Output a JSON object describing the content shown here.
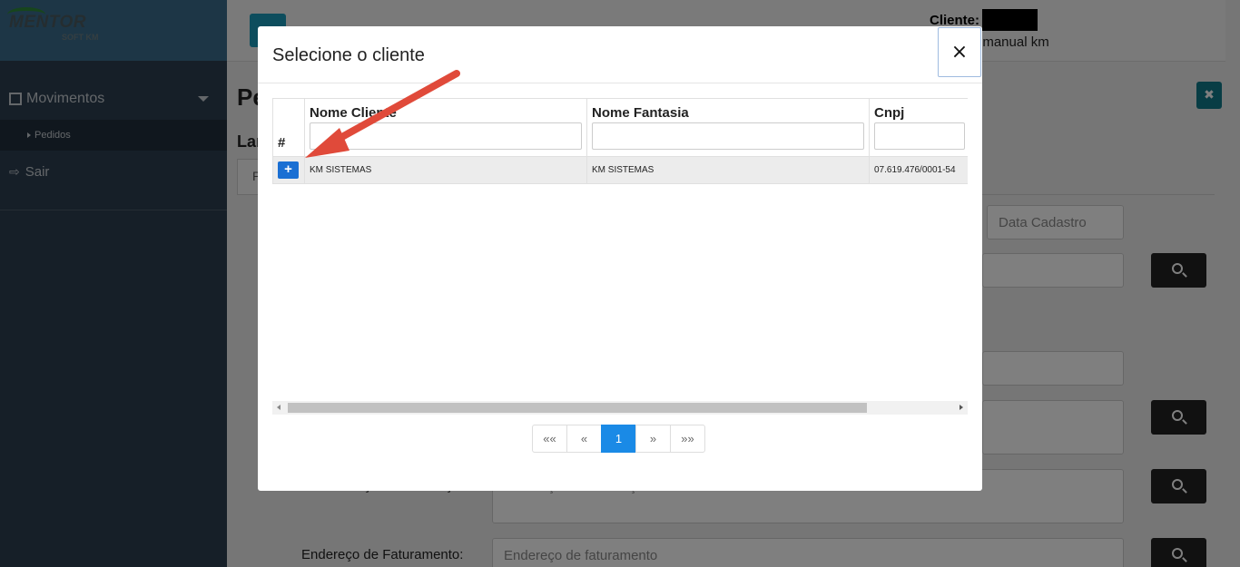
{
  "sidebar": {
    "logo": {
      "main": "MENTOR",
      "sub": "SOFT  KM"
    },
    "nav": {
      "movimentos": "Movimentos",
      "pedidos": "Pedidos",
      "sair": "Sair"
    }
  },
  "topbar": {
    "cliente_label": "Cliente:",
    "cliente_sub": ": manual km"
  },
  "page": {
    "title_partial": "Pe",
    "section_partial": "Lar",
    "tab_partial": "P",
    "close_icon": "✖",
    "data_cadastro_placeholder": "Data Cadastro",
    "endereco_cobranca_label": "Endereço de Cobrança:",
    "endereco_cobranca_placeholder": "Endereço de Cobrança",
    "endereco_faturamento_label": "Endereço de Faturamento:",
    "endereco_faturamento_placeholder": "Endereço de faturamento"
  },
  "modal": {
    "title": "Selecione o cliente",
    "close": "×",
    "table": {
      "headers": {
        "hash": "#",
        "nome_cliente": "Nome Cliente",
        "nome_fantasia": "Nome Fantasia",
        "cnpj": "Cnpj"
      },
      "rows": [
        {
          "add": "+",
          "nome_cliente": "KM SISTEMAS",
          "nome_fantasia": "KM SISTEMAS",
          "cnpj": "07.619.476/0001-54"
        }
      ]
    },
    "pagination": {
      "first": "««",
      "prev": "«",
      "current": "1",
      "next": "»",
      "last": "»»"
    }
  },
  "colors": {
    "primary": "#1a6fd3",
    "sidebar": "#2c3e50",
    "arrow": "#e04a3a"
  }
}
